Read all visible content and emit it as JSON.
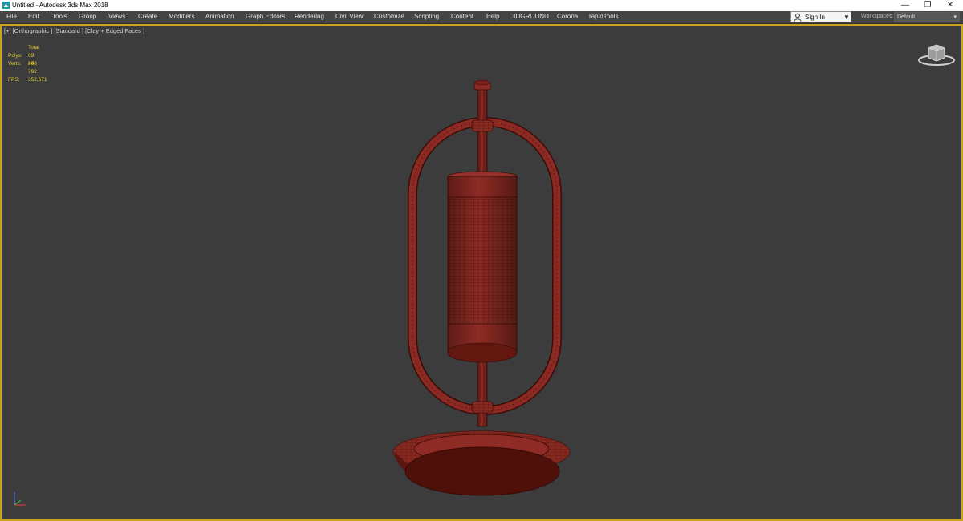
{
  "window": {
    "title": "Untitled - Autodesk 3ds Max 2018",
    "minimize_glyph": "—",
    "restore_glyph": "❐",
    "close_glyph": "✕"
  },
  "menu": {
    "items": [
      "File",
      "Edit",
      "Tools",
      "Group",
      "Views",
      "Create",
      "Modifiers",
      "Animation",
      "Graph Editors",
      "Rendering",
      "Civil View",
      "Customize",
      "Scripting",
      "Content",
      "Help",
      "3DGROUND",
      "Corona",
      "rapidTools"
    ]
  },
  "account": {
    "signin_label": "Sign In",
    "workspaces_label": "Workspaces:",
    "workspace_value": "Default"
  },
  "viewport": {
    "labels": "[+] [Orthographic ] [Standard ] [Clay + Edged Faces ]",
    "stats": {
      "header": "Total",
      "polys_label": "Polys:",
      "polys_value": "69 408",
      "verts_label": "Verts:",
      "verts_value": "34 792",
      "fps_label": "FPS:",
      "fps_value": "352,671"
    }
  },
  "icons": {
    "app": "3ds-max-app-icon",
    "user": "user-icon",
    "navcube": "viewcube-icon",
    "axis": "axis-tripod-icon"
  },
  "colors": {
    "viewport_border": "#c9a21e",
    "stats_text": "#e3d33a",
    "model_clay": "#8a2a22",
    "wire": "#3a0c08"
  }
}
